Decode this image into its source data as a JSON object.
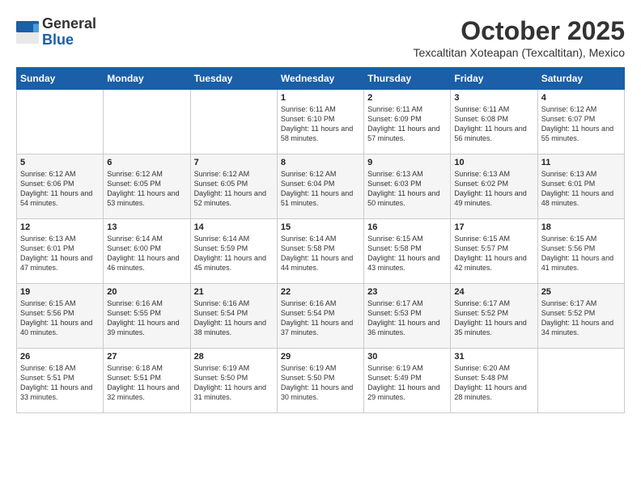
{
  "logo": {
    "general": "General",
    "blue": "Blue"
  },
  "title": "October 2025",
  "location": "Texcaltitan Xoteapan (Texcaltitan), Mexico",
  "weekdays": [
    "Sunday",
    "Monday",
    "Tuesday",
    "Wednesday",
    "Thursday",
    "Friday",
    "Saturday"
  ],
  "weeks": [
    [
      {
        "day": "",
        "sunrise": "",
        "sunset": "",
        "daylight": ""
      },
      {
        "day": "",
        "sunrise": "",
        "sunset": "",
        "daylight": ""
      },
      {
        "day": "",
        "sunrise": "",
        "sunset": "",
        "daylight": ""
      },
      {
        "day": "1",
        "sunrise": "Sunrise: 6:11 AM",
        "sunset": "Sunset: 6:10 PM",
        "daylight": "Daylight: 11 hours and 58 minutes."
      },
      {
        "day": "2",
        "sunrise": "Sunrise: 6:11 AM",
        "sunset": "Sunset: 6:09 PM",
        "daylight": "Daylight: 11 hours and 57 minutes."
      },
      {
        "day": "3",
        "sunrise": "Sunrise: 6:11 AM",
        "sunset": "Sunset: 6:08 PM",
        "daylight": "Daylight: 11 hours and 56 minutes."
      },
      {
        "day": "4",
        "sunrise": "Sunrise: 6:12 AM",
        "sunset": "Sunset: 6:07 PM",
        "daylight": "Daylight: 11 hours and 55 minutes."
      }
    ],
    [
      {
        "day": "5",
        "sunrise": "Sunrise: 6:12 AM",
        "sunset": "Sunset: 6:06 PM",
        "daylight": "Daylight: 11 hours and 54 minutes."
      },
      {
        "day": "6",
        "sunrise": "Sunrise: 6:12 AM",
        "sunset": "Sunset: 6:05 PM",
        "daylight": "Daylight: 11 hours and 53 minutes."
      },
      {
        "day": "7",
        "sunrise": "Sunrise: 6:12 AM",
        "sunset": "Sunset: 6:05 PM",
        "daylight": "Daylight: 11 hours and 52 minutes."
      },
      {
        "day": "8",
        "sunrise": "Sunrise: 6:12 AM",
        "sunset": "Sunset: 6:04 PM",
        "daylight": "Daylight: 11 hours and 51 minutes."
      },
      {
        "day": "9",
        "sunrise": "Sunrise: 6:13 AM",
        "sunset": "Sunset: 6:03 PM",
        "daylight": "Daylight: 11 hours and 50 minutes."
      },
      {
        "day": "10",
        "sunrise": "Sunrise: 6:13 AM",
        "sunset": "Sunset: 6:02 PM",
        "daylight": "Daylight: 11 hours and 49 minutes."
      },
      {
        "day": "11",
        "sunrise": "Sunrise: 6:13 AM",
        "sunset": "Sunset: 6:01 PM",
        "daylight": "Daylight: 11 hours and 48 minutes."
      }
    ],
    [
      {
        "day": "12",
        "sunrise": "Sunrise: 6:13 AM",
        "sunset": "Sunset: 6:01 PM",
        "daylight": "Daylight: 11 hours and 47 minutes."
      },
      {
        "day": "13",
        "sunrise": "Sunrise: 6:14 AM",
        "sunset": "Sunset: 6:00 PM",
        "daylight": "Daylight: 11 hours and 46 minutes."
      },
      {
        "day": "14",
        "sunrise": "Sunrise: 6:14 AM",
        "sunset": "Sunset: 5:59 PM",
        "daylight": "Daylight: 11 hours and 45 minutes."
      },
      {
        "day": "15",
        "sunrise": "Sunrise: 6:14 AM",
        "sunset": "Sunset: 5:58 PM",
        "daylight": "Daylight: 11 hours and 44 minutes."
      },
      {
        "day": "16",
        "sunrise": "Sunrise: 6:15 AM",
        "sunset": "Sunset: 5:58 PM",
        "daylight": "Daylight: 11 hours and 43 minutes."
      },
      {
        "day": "17",
        "sunrise": "Sunrise: 6:15 AM",
        "sunset": "Sunset: 5:57 PM",
        "daylight": "Daylight: 11 hours and 42 minutes."
      },
      {
        "day": "18",
        "sunrise": "Sunrise: 6:15 AM",
        "sunset": "Sunset: 5:56 PM",
        "daylight": "Daylight: 11 hours and 41 minutes."
      }
    ],
    [
      {
        "day": "19",
        "sunrise": "Sunrise: 6:15 AM",
        "sunset": "Sunset: 5:56 PM",
        "daylight": "Daylight: 11 hours and 40 minutes."
      },
      {
        "day": "20",
        "sunrise": "Sunrise: 6:16 AM",
        "sunset": "Sunset: 5:55 PM",
        "daylight": "Daylight: 11 hours and 39 minutes."
      },
      {
        "day": "21",
        "sunrise": "Sunrise: 6:16 AM",
        "sunset": "Sunset: 5:54 PM",
        "daylight": "Daylight: 11 hours and 38 minutes."
      },
      {
        "day": "22",
        "sunrise": "Sunrise: 6:16 AM",
        "sunset": "Sunset: 5:54 PM",
        "daylight": "Daylight: 11 hours and 37 minutes."
      },
      {
        "day": "23",
        "sunrise": "Sunrise: 6:17 AM",
        "sunset": "Sunset: 5:53 PM",
        "daylight": "Daylight: 11 hours and 36 minutes."
      },
      {
        "day": "24",
        "sunrise": "Sunrise: 6:17 AM",
        "sunset": "Sunset: 5:52 PM",
        "daylight": "Daylight: 11 hours and 35 minutes."
      },
      {
        "day": "25",
        "sunrise": "Sunrise: 6:17 AM",
        "sunset": "Sunset: 5:52 PM",
        "daylight": "Daylight: 11 hours and 34 minutes."
      }
    ],
    [
      {
        "day": "26",
        "sunrise": "Sunrise: 6:18 AM",
        "sunset": "Sunset: 5:51 PM",
        "daylight": "Daylight: 11 hours and 33 minutes."
      },
      {
        "day": "27",
        "sunrise": "Sunrise: 6:18 AM",
        "sunset": "Sunset: 5:51 PM",
        "daylight": "Daylight: 11 hours and 32 minutes."
      },
      {
        "day": "28",
        "sunrise": "Sunrise: 6:19 AM",
        "sunset": "Sunset: 5:50 PM",
        "daylight": "Daylight: 11 hours and 31 minutes."
      },
      {
        "day": "29",
        "sunrise": "Sunrise: 6:19 AM",
        "sunset": "Sunset: 5:50 PM",
        "daylight": "Daylight: 11 hours and 30 minutes."
      },
      {
        "day": "30",
        "sunrise": "Sunrise: 6:19 AM",
        "sunset": "Sunset: 5:49 PM",
        "daylight": "Daylight: 11 hours and 29 minutes."
      },
      {
        "day": "31",
        "sunrise": "Sunrise: 6:20 AM",
        "sunset": "Sunset: 5:48 PM",
        "daylight": "Daylight: 11 hours and 28 minutes."
      },
      {
        "day": "",
        "sunrise": "",
        "sunset": "",
        "daylight": ""
      }
    ]
  ]
}
